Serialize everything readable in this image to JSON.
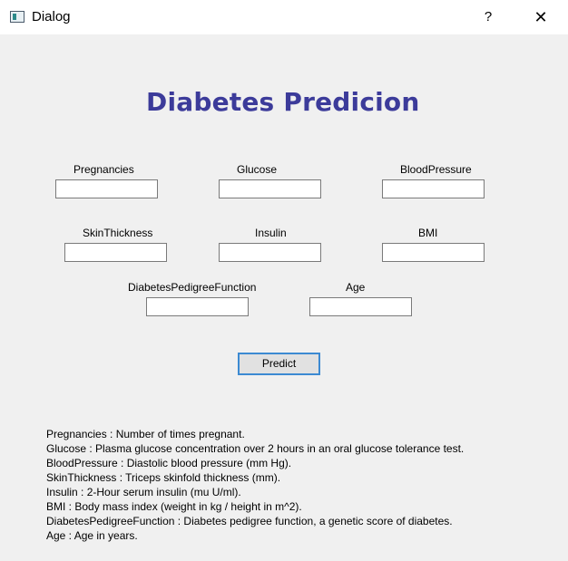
{
  "window": {
    "title": "Dialog",
    "help_label": "?",
    "close_label": "✕"
  },
  "heading": "Diabetes Predicion",
  "fields": {
    "pregnancies": {
      "label": "Pregnancies",
      "value": ""
    },
    "glucose": {
      "label": "Glucose",
      "value": ""
    },
    "blood_pressure": {
      "label": "BloodPressure",
      "value": ""
    },
    "skin_thickness": {
      "label": "SkinThickness",
      "value": ""
    },
    "insulin": {
      "label": "Insulin",
      "value": ""
    },
    "bmi": {
      "label": "BMI",
      "value": ""
    },
    "dpf": {
      "label": "DiabetesPedigreeFunction",
      "value": ""
    },
    "age": {
      "label": "Age",
      "value": ""
    }
  },
  "predict_label": "Predict",
  "descriptions": [
    "Pregnancies : Number of times pregnant.",
    "Glucose : Plasma glucose concentration over 2 hours in an oral glucose tolerance test.",
    "BloodPressure : Diastolic blood pressure (mm Hg).",
    "SkinThickness : Triceps skinfold thickness (mm).",
    "Insulin : 2-Hour serum insulin (mu U/ml).",
    "BMI : Body mass index (weight in kg / height in m^2).",
    "DiabetesPedigreeFunction : Diabetes pedigree function, a genetic score of diabetes.",
    "Age : Age in years."
  ],
  "colors": {
    "heading": "#3c3b9a",
    "button_border": "#3c8ad2",
    "background": "#f0f0f0"
  },
  "icons": {
    "app": "window-app-icon",
    "help": "help-icon",
    "close": "close-icon"
  }
}
